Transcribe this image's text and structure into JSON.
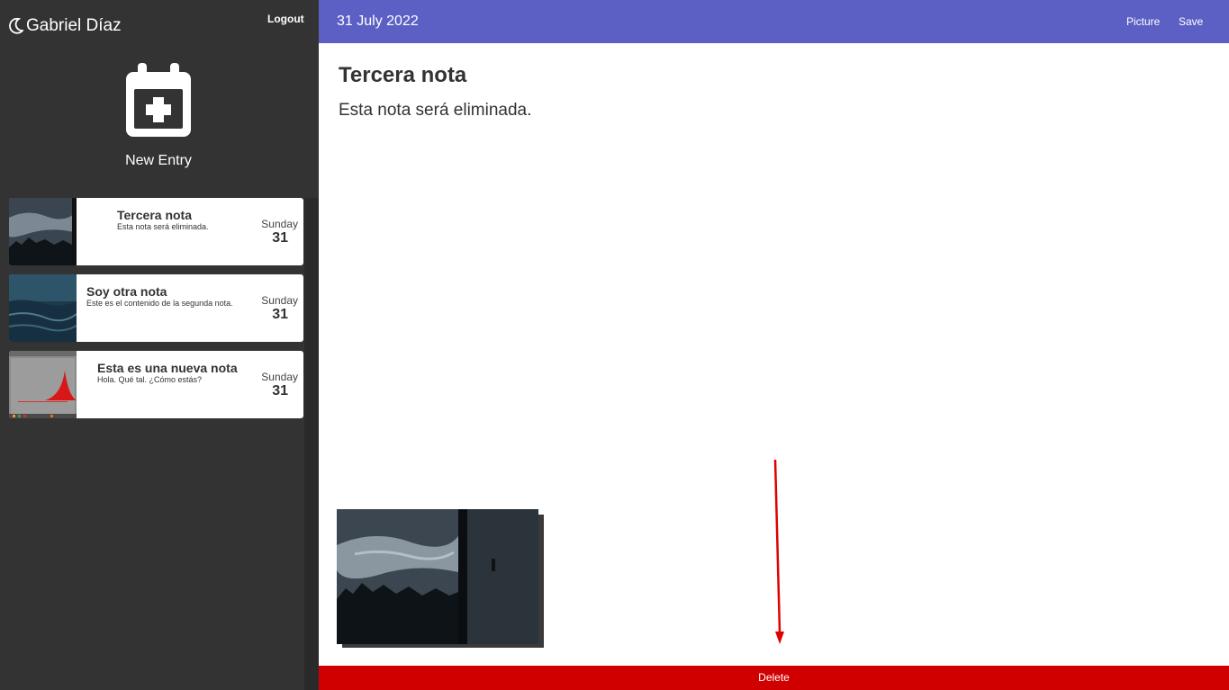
{
  "sidebar": {
    "user_name": "Gabriel Díaz",
    "logout_label": "Logout",
    "new_entry_label": "New Entry",
    "entries": [
      {
        "title": "Tercera nota",
        "text": "Esta nota será eliminada.",
        "day": "Sunday",
        "date": "31"
      },
      {
        "title": "Soy otra nota",
        "text": "Este es el contenido de la segunda nota.",
        "day": "Sunday",
        "date": "31"
      },
      {
        "title": "Esta es una nueva nota",
        "text": "Hola. Qué tal. ¿Cómo estás?",
        "day": "Sunday",
        "date": "31"
      }
    ]
  },
  "topbar": {
    "date": "31 July 2022",
    "picture_label": "Picture",
    "save_label": "Save"
  },
  "note": {
    "title": "Tercera nota",
    "body": "Esta nota será eliminada."
  },
  "delete_label": "Delete",
  "colors": {
    "sidebar_bg": "#333333",
    "topbar_bg": "#5c60c4",
    "delete_bg": "#d10000",
    "arrow": "#e00000"
  },
  "icons": {
    "brand": "moon-icon",
    "new_entry": "calendar-plus-icon"
  }
}
